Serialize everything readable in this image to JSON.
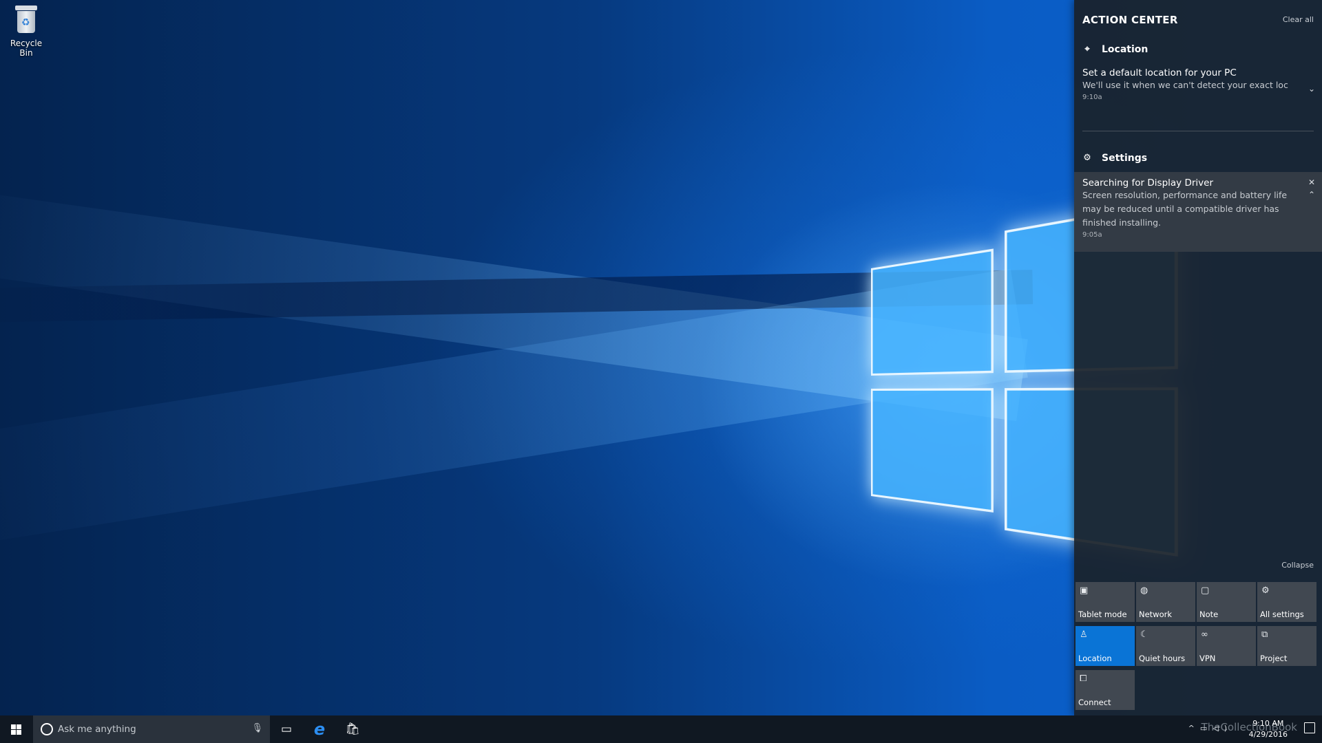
{
  "desktop": {
    "recycle_bin_label": "Recycle Bin"
  },
  "action_center": {
    "title": "ACTION CENTER",
    "clear_all": "Clear all",
    "collapse": "Collapse",
    "groups": [
      {
        "name": "Location",
        "icon": "location-group-icon",
        "notifications": [
          {
            "title": "Set a default location for your PC",
            "body": "We'll use it when we can't detect your exact loc",
            "time": "9:10a",
            "action": "chevron-down"
          }
        ]
      },
      {
        "name": "Settings",
        "icon": "gear-icon",
        "notifications": [
          {
            "title": "Searching for Display Driver",
            "body": "Screen resolution, performance and battery life may be reduced until a compatible driver has finished installing.",
            "time": "9:05a",
            "action": "close"
          }
        ]
      }
    ],
    "quick_actions": [
      {
        "label": "Tablet mode",
        "icon": "tablet-icon",
        "active": false
      },
      {
        "label": "Network",
        "icon": "globe-icon",
        "active": false
      },
      {
        "label": "Note",
        "icon": "note-icon",
        "active": false
      },
      {
        "label": "All settings",
        "icon": "gear-icon",
        "active": false
      },
      {
        "label": "Location",
        "icon": "location-icon",
        "active": true
      },
      {
        "label": "Quiet hours",
        "icon": "moon-icon",
        "active": false
      },
      {
        "label": "VPN",
        "icon": "vpn-icon",
        "active": false
      },
      {
        "label": "Project",
        "icon": "project-icon",
        "active": false
      },
      {
        "label": "Connect",
        "icon": "connect-icon",
        "active": false
      }
    ],
    "active_color": "#0a74d6"
  },
  "taskbar": {
    "search_placeholder": "Ask me anything",
    "watermark": "TheCollectionBook",
    "time": "9:10 AM",
    "date": "4/29/2016"
  }
}
